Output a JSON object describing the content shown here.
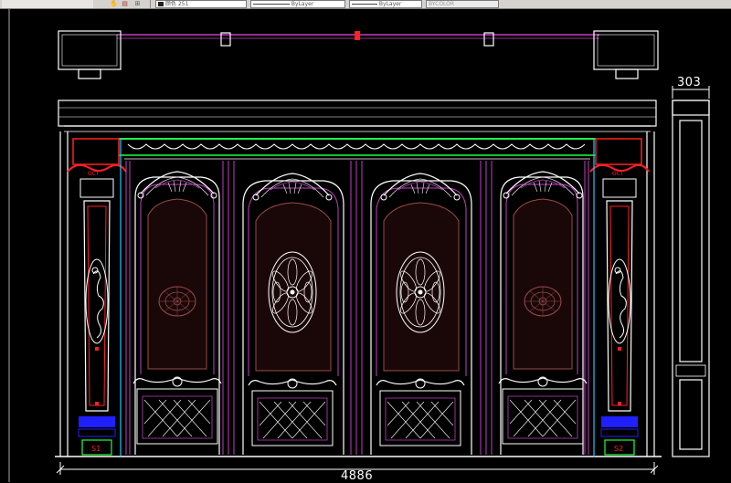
{
  "toolbar": {
    "color_label": "颜色",
    "color_value": "251",
    "linetype_value": "ByLayer",
    "lineweight_value": "ByLayer",
    "plotstyle_value": "BYCOLOR",
    "icons": [
      "pan-icon",
      "layer-properties-icon",
      "match-properties-icon"
    ]
  },
  "drawing": {
    "dim_overall": "4886",
    "dim_side": "303",
    "palette": {
      "background": "#000000",
      "outline": "#ffffff",
      "magenta": "#c040c0",
      "red": "#ff2020",
      "green": "#20ff40",
      "cyan": "#20c8ff",
      "blue": "#2020ff",
      "brown": "#9a4a4a"
    }
  }
}
